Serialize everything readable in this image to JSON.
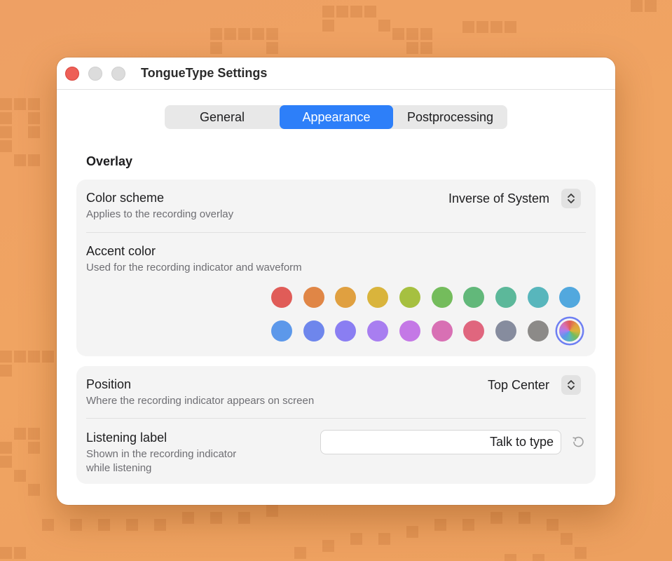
{
  "window": {
    "title": "TongueType Settings"
  },
  "tabs": [
    {
      "label": "General",
      "selected": false
    },
    {
      "label": "Appearance",
      "selected": true
    },
    {
      "label": "Postprocessing",
      "selected": false
    }
  ],
  "overlay": {
    "section_title": "Overlay",
    "color_scheme": {
      "label": "Color scheme",
      "description": "Applies to the recording overlay",
      "value": "Inverse of System"
    },
    "accent_color": {
      "label": "Accent color",
      "description": "Used for the recording indicator and waveform",
      "swatches": [
        "#e05c58",
        "#e08646",
        "#e0a040",
        "#d9b43c",
        "#a6c040",
        "#74bc5c",
        "#62b87a",
        "#5cb89a",
        "#58b6bc",
        "#52a8de",
        "#5c98ea",
        "#6e86ec",
        "#8a7ef2",
        "#a87ef0",
        "#c478e6",
        "#d870b4",
        "#e0667e",
        "#868c9e",
        "#8c8a88",
        "multicolor"
      ],
      "selected_index": 19
    }
  },
  "indicator": {
    "position": {
      "label": "Position",
      "description": "Where the recording indicator appears on screen",
      "value": "Top Center"
    },
    "listening_label": {
      "label": "Listening label",
      "description_line1": "Shown in the recording indicator",
      "description_line2": "while listening",
      "value": "Talk to type"
    }
  },
  "colors": {
    "accent": "#2d7ff9",
    "close_button": "#ee5f57",
    "background": "#f0a462"
  },
  "icons": [
    "chevron-up-down-icon",
    "reset-arrow-icon"
  ]
}
